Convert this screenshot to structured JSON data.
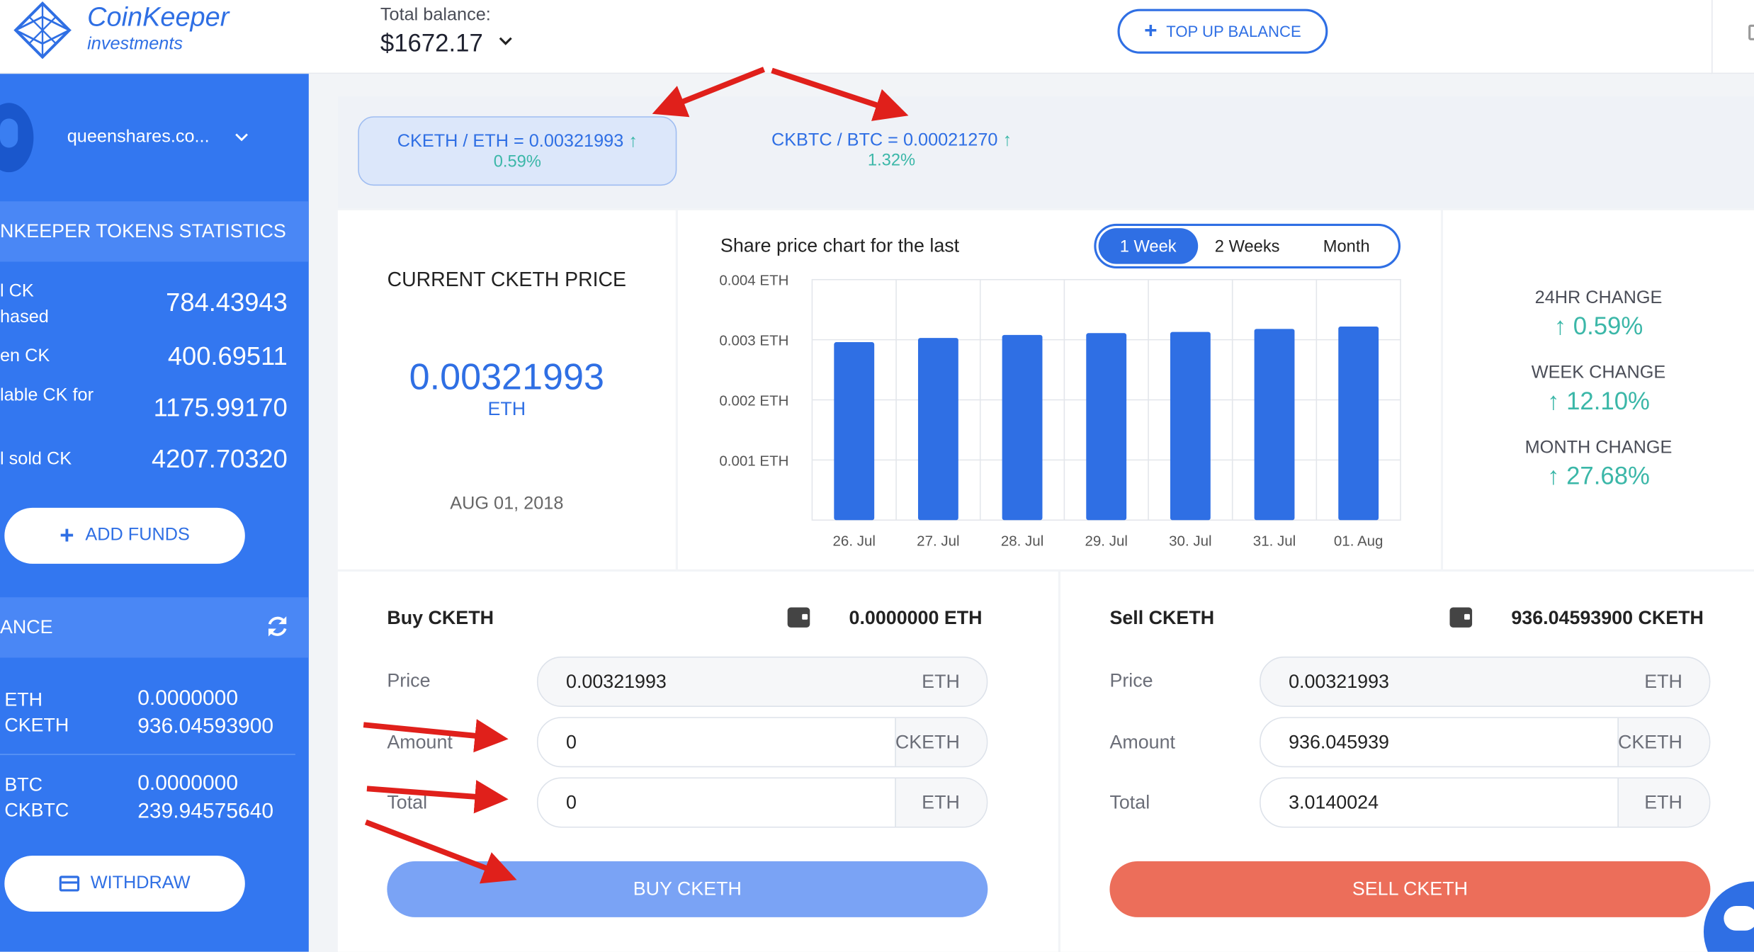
{
  "brand": {
    "name": "CoinKeeper",
    "sub": "investments"
  },
  "header": {
    "balance_label": "Total balance:",
    "balance_value": "$1672.17",
    "topup_label": "TOP UP BALANCE"
  },
  "sidebar": {
    "user": "queenshares.co...",
    "stats_title": "NKEEPER TOKENS STATISTICS",
    "stats": [
      {
        "label1": "l CK",
        "label2": "hased",
        "value": "784.43943"
      },
      {
        "label1": "en CK",
        "label2": "",
        "value": "400.69511"
      },
      {
        "label1": "lable CK for",
        "label2": "",
        "value": "1175.99170"
      },
      {
        "label1": "l sold CK",
        "label2": "",
        "value": "4207.70320"
      }
    ],
    "add_funds_label": "ADD FUNDS",
    "balance_title": "ANCE",
    "balances": [
      {
        "cur1": "ETH",
        "cur2": "CKETH",
        "val1": "0.0000000",
        "val2": "936.04593900"
      },
      {
        "cur1": "BTC",
        "cur2": "CKBTC",
        "val1": "0.0000000",
        "val2": "239.94575640"
      }
    ],
    "withdraw_label": "WITHDRAW"
  },
  "rates": [
    {
      "label": "CKETH / ETH = 0.00321993",
      "pct": "0.59%",
      "arrow": "↑"
    },
    {
      "label": "CKBTC / BTC = 0.00021270",
      "pct": "1.32%",
      "arrow": "↑"
    }
  ],
  "current": {
    "title": "CURRENT CKETH PRICE",
    "price": "0.00321993",
    "unit": "ETH",
    "date": "AUG 01, 2018"
  },
  "chart": {
    "title": "Share price chart for the last",
    "tabs": [
      "1 Week",
      "2 Weeks",
      "Month"
    ],
    "active_tab": 0
  },
  "chart_data": {
    "type": "bar",
    "categories": [
      "26. Jul",
      "27. Jul",
      "28. Jul",
      "29. Jul",
      "30. Jul",
      "31. Jul",
      "01. Aug"
    ],
    "values": [
      0.00296,
      0.00303,
      0.00308,
      0.00311,
      0.00313,
      0.00318,
      0.00322
    ],
    "yticks": [
      0.001,
      0.002,
      0.003,
      0.004
    ],
    "ytick_labels": [
      "0.001 ETH",
      "0.002 ETH",
      "0.003 ETH",
      "0.004 ETH"
    ],
    "ylim": [
      0,
      0.004
    ],
    "bar_color": "#2f6fe4",
    "grid": true
  },
  "changes": [
    {
      "label": "24HR CHANGE",
      "value": "0.59%",
      "arrow": "↑"
    },
    {
      "label": "WEEK CHANGE",
      "value": "12.10%",
      "arrow": "↑"
    },
    {
      "label": "MONTH CHANGE",
      "value": "27.68%",
      "arrow": "↑"
    }
  ],
  "buy": {
    "title": "Buy CKETH",
    "balance": "0.0000000 ETH",
    "price_label": "Price",
    "price": "0.00321993",
    "price_unit": "ETH",
    "amount_label": "Amount",
    "amount": "0",
    "amount_unit": "CKETH",
    "total_label": "Total",
    "total": "0",
    "total_unit": "ETH",
    "button": "BUY CKETH"
  },
  "sell": {
    "title": "Sell CKETH",
    "balance": "936.04593900 CKETH",
    "price_label": "Price",
    "price": "0.00321993",
    "price_unit": "ETH",
    "amount_label": "Amount",
    "amount": "936.045939",
    "amount_unit": "CKETH",
    "total_label": "Total",
    "total": "3.0140024",
    "total_unit": "ETH",
    "button": "SELL CKETH"
  },
  "colors": {
    "accent": "#2f6fe4",
    "sidebar": "#3377f0",
    "positive": "#3bb7a8",
    "buy_button": "#7aa3f5",
    "sell_button": "#ec6e5a",
    "annotation_arrow": "#e0201b"
  }
}
